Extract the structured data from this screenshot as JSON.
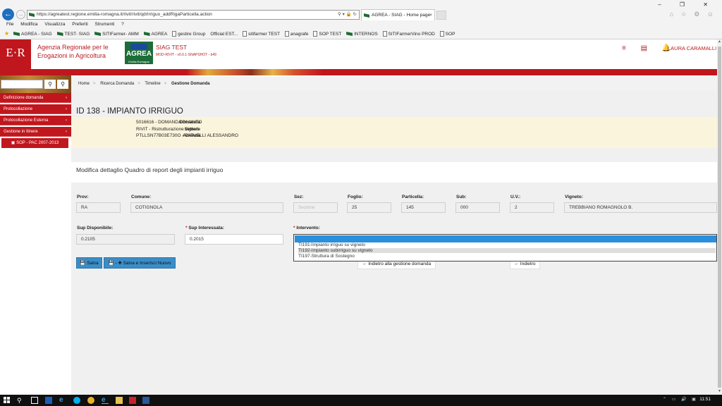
{
  "browser": {
    "url": "https://agreatest.regione.emilia-romagna.it/rivit/rivit/qdrIrriguo_addRigaParticella.action",
    "tab_title": "AGREA - SIAG - Home page",
    "tab_close": "×",
    "addr_icons": "⚲ ▾ 🔒 ↻",
    "window_controls": "– ❐ ✕",
    "tools": "⌂ ☆ ⚙ ☺",
    "menu": [
      "File",
      "Modifica",
      "Visualizza",
      "Preferiti",
      "Strumenti",
      "?"
    ],
    "favorites": [
      {
        "label": "AGREA - SIAG",
        "icon": "agrea-flag-icon"
      },
      {
        "label": "TEST- SIAG",
        "icon": "agrea-flag-icon"
      },
      {
        "label": "SITIFarmer- AMM",
        "icon": "agrea-flag-icon"
      },
      {
        "label": "AGREA",
        "icon": "agrea-flag-icon"
      },
      {
        "label": "gestire Group",
        "icon": "page-icon"
      },
      {
        "label": "Official EST...",
        "icon": "none"
      },
      {
        "label": "sitifarmer TEST",
        "icon": "page-icon"
      },
      {
        "label": "anagrafe",
        "icon": "page-icon"
      },
      {
        "label": "SOP TEST",
        "icon": "page-icon"
      },
      {
        "label": "INTERNOS",
        "icon": "agrea-flag-icon"
      },
      {
        "label": "SITIFarmerVino PROD",
        "icon": "page-icon"
      },
      {
        "label": "SOP",
        "icon": "page-icon"
      }
    ]
  },
  "header": {
    "er_logo": "E·R",
    "agency_line1": "Agenzia Regionale per le",
    "agency_line2": "Erogazioni in Agricoltura",
    "agrea_logo": "AGREA",
    "agrea_sub": "Emilia-Romagna",
    "app_title": "SIAG TEST",
    "app_version": "MOD-RIVIT - v0.0.1-SNAPSHOT - b49",
    "icons": "≡ ▤ 🔔",
    "user": "LAURA CARAMALLI"
  },
  "sidebar": {
    "search_placeholder": "",
    "items": [
      {
        "label": "Definizione domanda"
      },
      {
        "label": "Protocollazione"
      },
      {
        "label": "Protocollazione Esterna"
      },
      {
        "label": "Gestione in Itinere"
      }
    ],
    "sop_label": "SOP - PAC 2007-2013",
    "chev": "‹"
  },
  "breadcrumb": {
    "items": [
      "Home",
      "Ricerca Domanda",
      "Timeline"
    ],
    "current": "Gestione Domanda",
    "sep": ">"
  },
  "page": {
    "title": "ID 138 - IMPIANTO IRRIGUO",
    "summary": [
      {
        "label": "Domanda",
        "value": "5016616 - DOMANDA DI AIUTO"
      },
      {
        "label": "Settore",
        "value": "RIVIT - Ristrutturazione vigneti"
      },
      {
        "label": "Azienda",
        "value": "PTLLSN77B03E730O - PATUELLI ALESSANDRO"
      }
    ],
    "panel_title": "Modifica dettaglio Quadro di report degli impianti irriguo"
  },
  "form": {
    "prov": {
      "label": "Prov:",
      "value": "RA"
    },
    "comune": {
      "label": "Comune:",
      "value": "COTIGNOLA"
    },
    "sez": {
      "label": "Sez:",
      "value": "Sezione"
    },
    "foglio": {
      "label": "Foglio:",
      "value": "25"
    },
    "particella": {
      "label": "Particella:",
      "value": "145"
    },
    "sub": {
      "label": "Sub:",
      "value": "000"
    },
    "uv": {
      "label": "U.V.:",
      "value": "2"
    },
    "vigneto": {
      "label": "Vigneto:",
      "value": "TREBBIANO ROMAGNOLO B."
    },
    "sup_disp": {
      "label": "Sup Disponibile:",
      "value": "0.2105"
    },
    "sup_int": {
      "label": "Sup Interessata:",
      "value": "0.2015",
      "required_mark": "*"
    },
    "intervento": {
      "label": "Intervento:",
      "required_mark": "*",
      "options": [
        "TI191-Impianto irriguo su vigneto",
        "TI192-Impianto subirriguo su vigneto",
        "TI197-Struttura di Sostegno"
      ]
    }
  },
  "buttons": {
    "salva": "💾 Salva",
    "salva_nuovo": "💾 - ✚ Salva e Inserisci Nuovo",
    "indietro_gestione": "← Indietro alla gestione domanda",
    "indietro": "← Indietro"
  },
  "taskbar": {
    "clock": "11:51",
    "tray": "⌃ ▭ 🔊 ▣"
  }
}
